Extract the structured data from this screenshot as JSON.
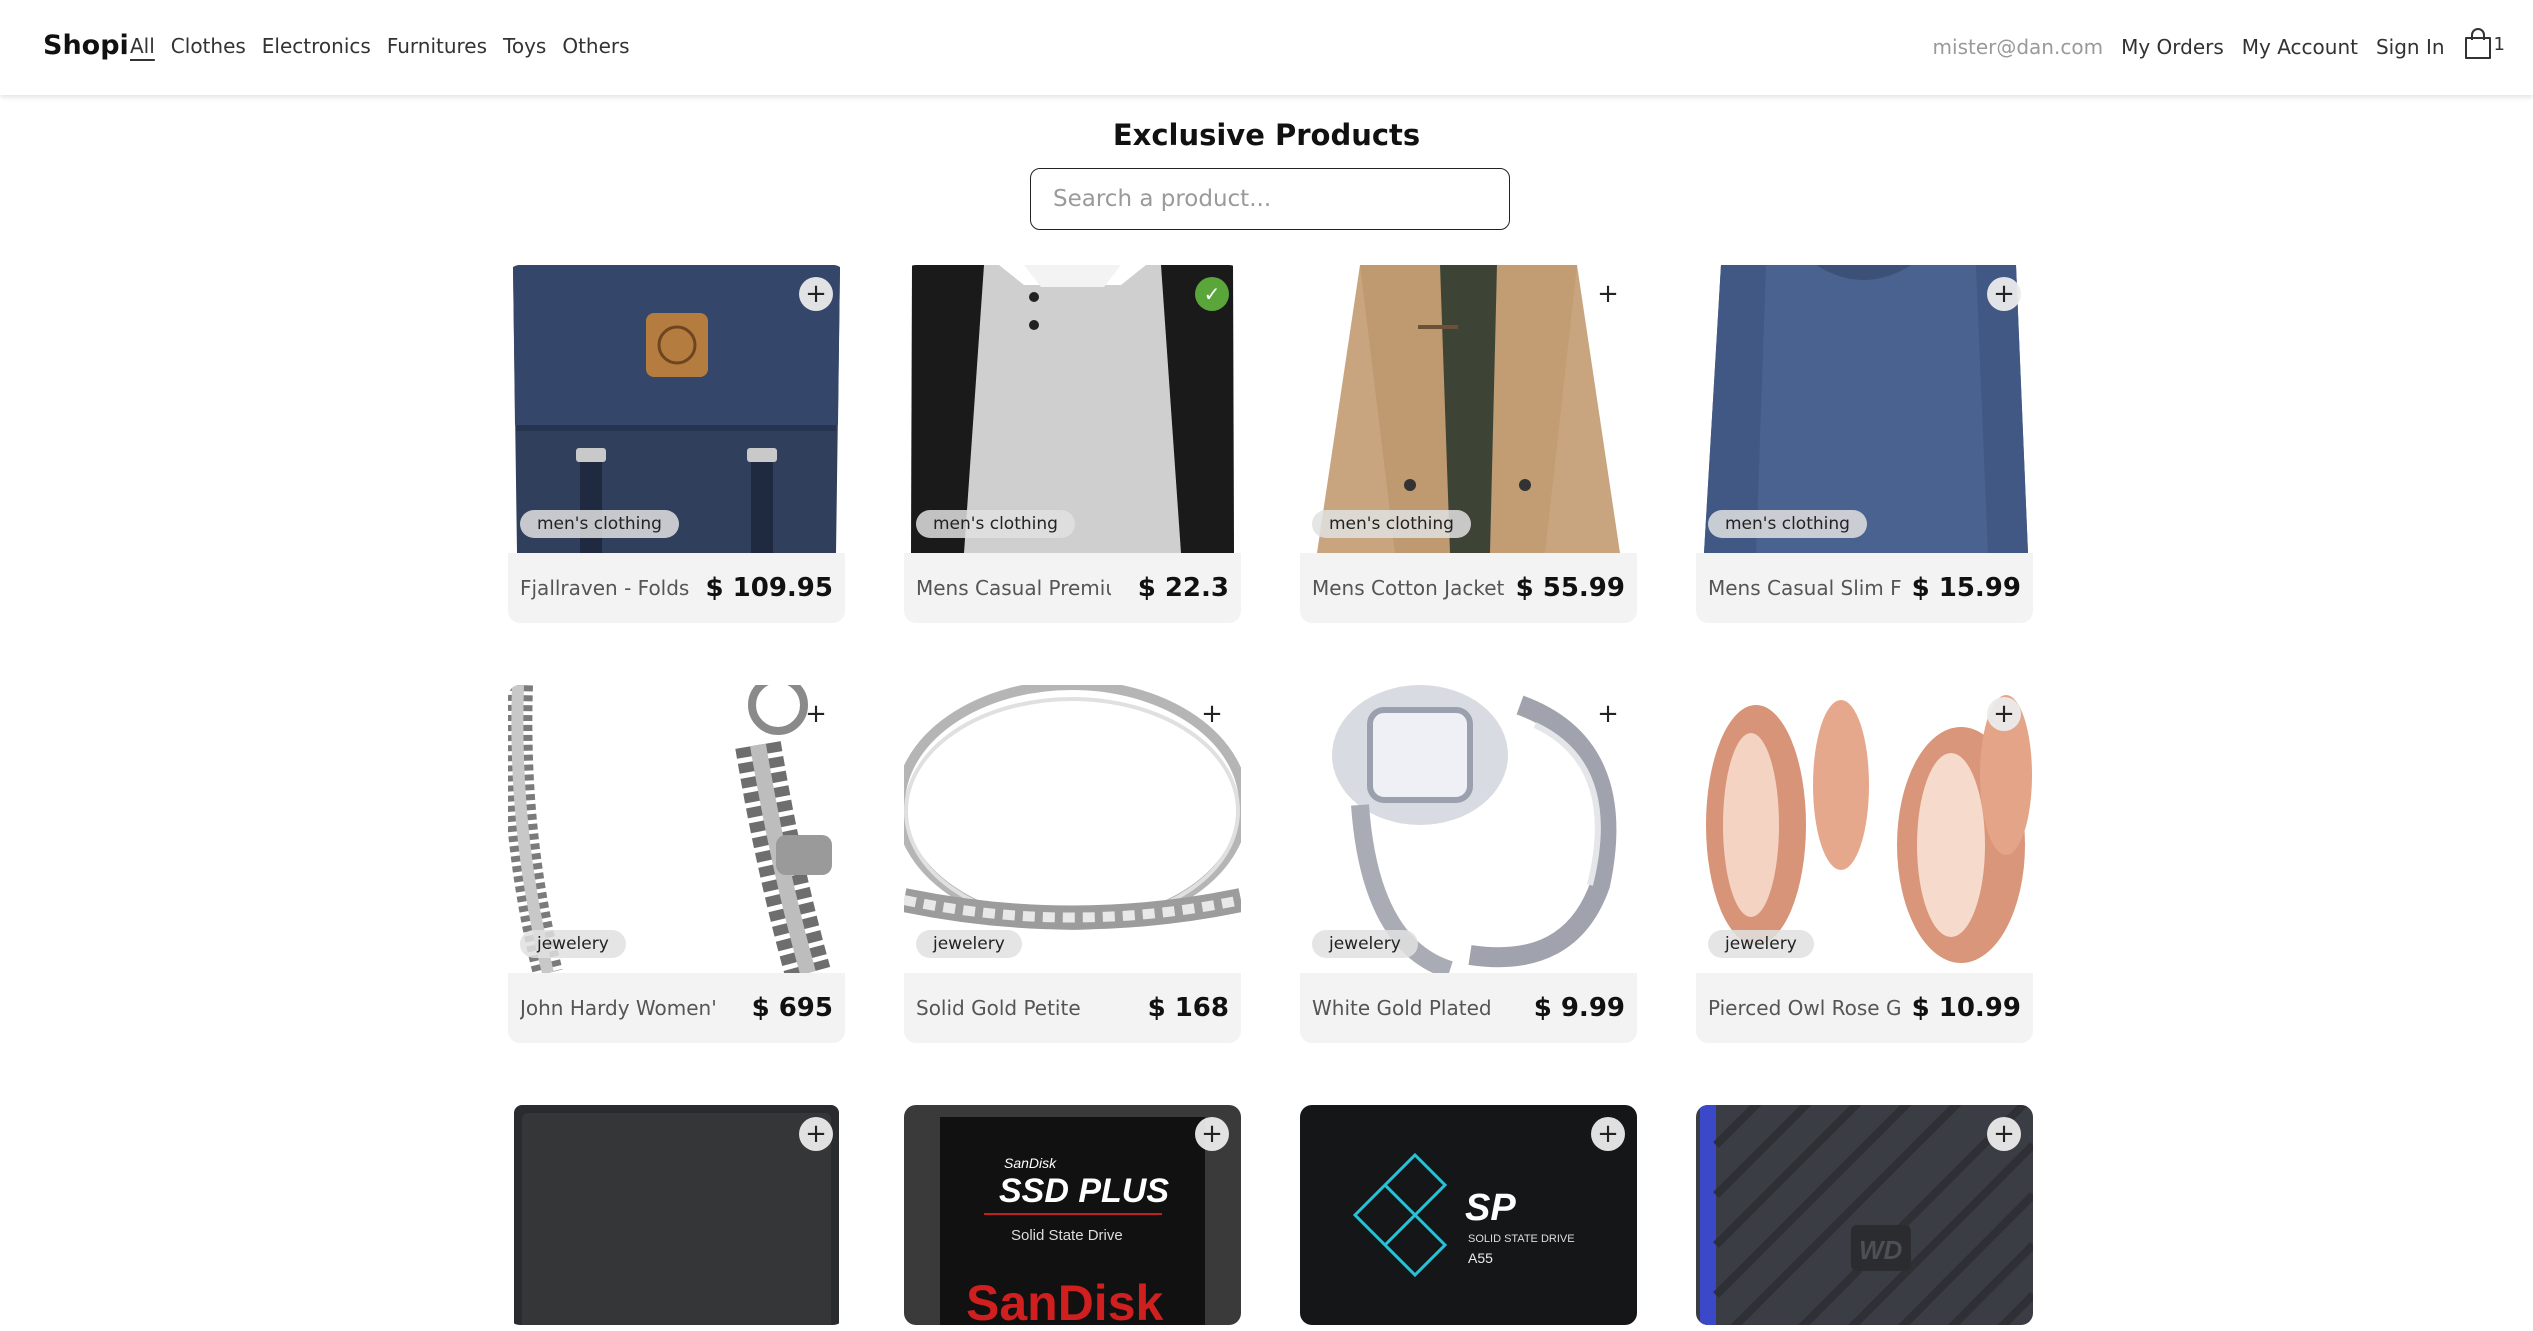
{
  "brand": "Shopi",
  "nav": {
    "categories": [
      "All",
      "Clothes",
      "Electronics",
      "Furnitures",
      "Toys",
      "Others"
    ],
    "active": "All",
    "email": "mister@dan.com",
    "my_orders": "My Orders",
    "my_account": "My Account",
    "sign_in": "Sign In",
    "cart_count": "1"
  },
  "header": {
    "title": "Exclusive Products",
    "search_placeholder": "Search a product..."
  },
  "products": [
    {
      "title": "Fjallraven - Folds",
      "price": "$ 109.95",
      "category": "men's clothing",
      "added": false,
      "icon": "backpack-image"
    },
    {
      "title": "Mens Casual Premiu",
      "price": "$ 22.3",
      "category": "men's clothing",
      "added": true,
      "icon": "raglan-tshirt-image"
    },
    {
      "title": "Mens Cotton Jacket",
      "price": "$ 55.99",
      "category": "men's clothing",
      "added": false,
      "icon": "cotton-jacket-image"
    },
    {
      "title": "Mens Casual Slim F",
      "price": "$ 15.99",
      "category": "men's clothing",
      "added": false,
      "icon": "long-sleeve-shirt-image"
    },
    {
      "title": "John Hardy Women's",
      "price": "$ 695",
      "category": "jewelery",
      "added": false,
      "icon": "chain-bracelet-image"
    },
    {
      "title": "Solid Gold Petite",
      "price": "$ 168",
      "category": "jewelery",
      "added": false,
      "icon": "diamond-band-image"
    },
    {
      "title": "White Gold Plated",
      "price": "$ 9.99",
      "category": "jewelery",
      "added": false,
      "icon": "halo-ring-image"
    },
    {
      "title": "Pierced Owl Rose G",
      "price": "$ 10.99",
      "category": "jewelery",
      "added": false,
      "icon": "rose-gold-plugs-image"
    },
    {
      "title": "",
      "price": "",
      "category": "",
      "added": false,
      "icon": "external-drive-image"
    },
    {
      "title": "",
      "price": "",
      "category": "",
      "added": false,
      "icon": "sandisk-ssd-image",
      "image_text": [
        "SanDisk",
        "SSD PLUS",
        "Solid State Drive",
        "SanDisk"
      ]
    },
    {
      "title": "",
      "price": "",
      "category": "",
      "added": false,
      "icon": "sp-ssd-image",
      "image_text": [
        "SP",
        "SOLID STATE DRIVE",
        "A55"
      ]
    },
    {
      "title": "",
      "price": "",
      "category": "",
      "added": false,
      "icon": "wd-drive-image",
      "image_text": [
        "WD"
      ]
    }
  ],
  "colors": {
    "card_bg": "#f3f3f3",
    "added_check": "#5aa63a",
    "muted_text": "#9a9a9a"
  }
}
